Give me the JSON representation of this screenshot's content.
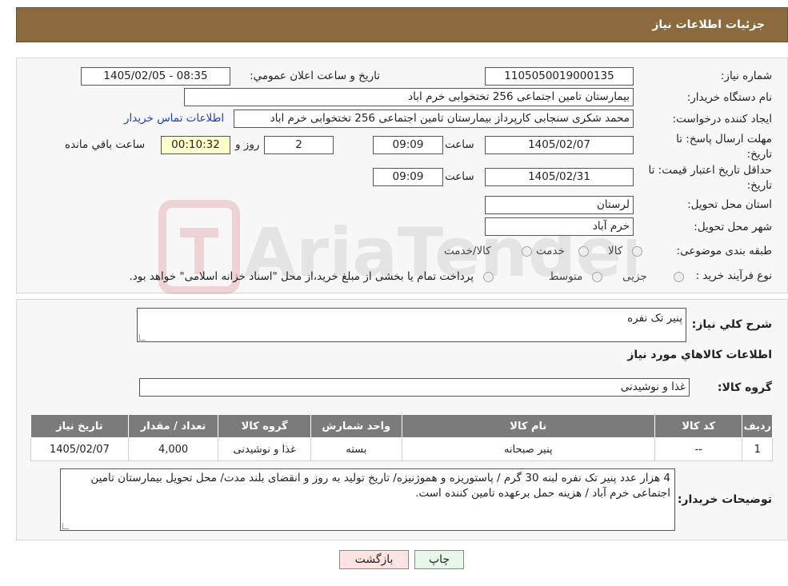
{
  "header": {
    "title": "جزئیات اطلاعات نیاز"
  },
  "form": {
    "need_number_label": "شماره نیاز:",
    "need_number": "1105050019000135",
    "announce_label": "تاریخ و ساعت اعلان عمومي:",
    "announce_value": "1405/02/05 - 08:35",
    "buyer_org_label": "نام دستگاه خریدار:",
    "buyer_org": "بیمارستان تامین اجتماعی  256 تختخوابی خرم اباد",
    "creator_label": "ایجاد کننده درخواست:",
    "creator": "محمد شکری سنجابی کارپرداز بیمارستان تامین اجتماعی  256 تختخوابی خرم اباد",
    "contact_link": "اطلاعات تماس خریدار",
    "deadline_label_1": "مهلت ارسال پاسخ: تا",
    "deadline_label_2": "تاریخ:",
    "deadline_date": "1405/02/07",
    "time_label": "ساعت",
    "deadline_time": "09:09",
    "days_value": "2",
    "days_label": "روز و",
    "remaining_value": "00:10:32",
    "remaining_label": "ساعت باقي مانده",
    "validity_label_1": "حداقل تاریخ اعتبار قیمت: تا",
    "validity_label_2": "تاریخ:",
    "validity_date": "1405/02/31",
    "validity_time": "09:09",
    "province_label": "استان محل تحویل:",
    "province": "لرستان",
    "city_label": "شهر محل تحویل:",
    "city": "خرم آباد",
    "category_label": "طبقه بندی موضوعی:",
    "category_options": [
      "کالا",
      "خدمت",
      "کالا/خدمت"
    ],
    "process_label": "نوع فرآیند خرید :",
    "process_options": [
      "جزیی",
      "متوسط"
    ],
    "process_note": "پرداخت تمام یا بخشی از مبلغ خرید،از محل \"اسناد خزانه اسلامی\" خواهد بود."
  },
  "summary": {
    "desc_label": "شرح کلي نياز:",
    "desc_value": "پنیر تک نفره",
    "items_heading": "اطلاعات کالاهاي مورد نياز",
    "group_label": "گروه کالا:",
    "group_value": "غذا و نوشیدنی"
  },
  "table": {
    "headers": [
      "رديف",
      "کد کالا",
      "نام کالا",
      "واحد شمارش",
      "گروه کالا",
      "تعداد / مقدار",
      "تاریخ نیاز"
    ],
    "rows": [
      [
        "1",
        "--",
        "پنیر صبحانه",
        "بسته",
        "غذا و نوشیدنی",
        "4,000",
        "1405/02/07"
      ]
    ]
  },
  "buyer_notes": {
    "label": "توضیحات خریدار:",
    "text": "4 هزار عدد پنیر تک نفره لبنه 30 گرم  / پاستوریزه و هموژنیزه/ تاریخ تولید به روز و انقضای بلند مدت/ محل تحویل بیمارستان تامین اجتماعی خرم آباد / هزینه حمل برعهده تامین کننده است."
  },
  "buttons": {
    "print": "چاپ",
    "back": "بازگشت"
  },
  "watermark": {
    "brand": "AriaTender.neT"
  },
  "colors": {
    "header": "#8b6a3e",
    "link": "#1a3ec9",
    "back_button": "#ffe2e2",
    "print_button": "#e8f8e8"
  }
}
